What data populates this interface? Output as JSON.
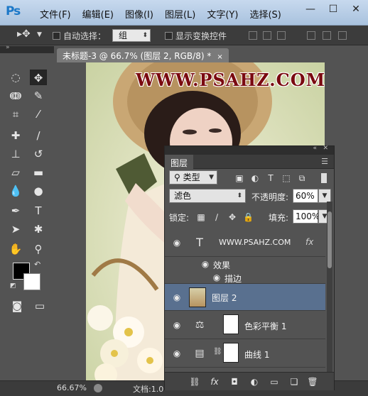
{
  "app": {
    "logo": "Ps",
    "menu": [
      "文件(F)",
      "编辑(E)",
      "图像(I)",
      "图层(L)",
      "文字(Y)",
      "选择(S)"
    ],
    "window_controls": [
      "minimize-icon",
      "maximize-icon",
      "close-icon"
    ]
  },
  "options_bar": {
    "auto_select_label": "自动选择：",
    "auto_select_value": "组",
    "show_transform_label": "显示变换控件"
  },
  "document": {
    "tab_title": "未标题-3 @ 66.7% (图层 2, RGB/8) *",
    "close": "×",
    "watermark": "WWW.PSAHZ.COM"
  },
  "status": {
    "zoom": "66.67%",
    "doc_label": "文档:1.0"
  },
  "layers_panel": {
    "tab": "图层",
    "filter_kind": "类型",
    "blend_mode": "滤色",
    "opacity_label": "不透明度:",
    "opacity_value": "60%",
    "lock_label": "锁定:",
    "fill_label": "填充:",
    "fill_value": "100%",
    "layers": [
      {
        "name": "WWW.PSAHZ.COM",
        "kind": "text",
        "fx": "fx"
      },
      {
        "name": "效果",
        "kind": "effects-group"
      },
      {
        "name": "描边",
        "kind": "effect"
      },
      {
        "name": "图层 2",
        "kind": "pixel",
        "selected": true
      },
      {
        "name": "色彩平衡 1",
        "kind": "adjustment",
        "icon": "balance-icon"
      },
      {
        "name": "曲线 1",
        "kind": "adjustment",
        "icon": "curves-icon"
      }
    ]
  },
  "colors": {
    "foreground": "#000000",
    "background": "#ffffff",
    "selected_layer": "#59708f",
    "watermark_color": "#7a0a10"
  }
}
